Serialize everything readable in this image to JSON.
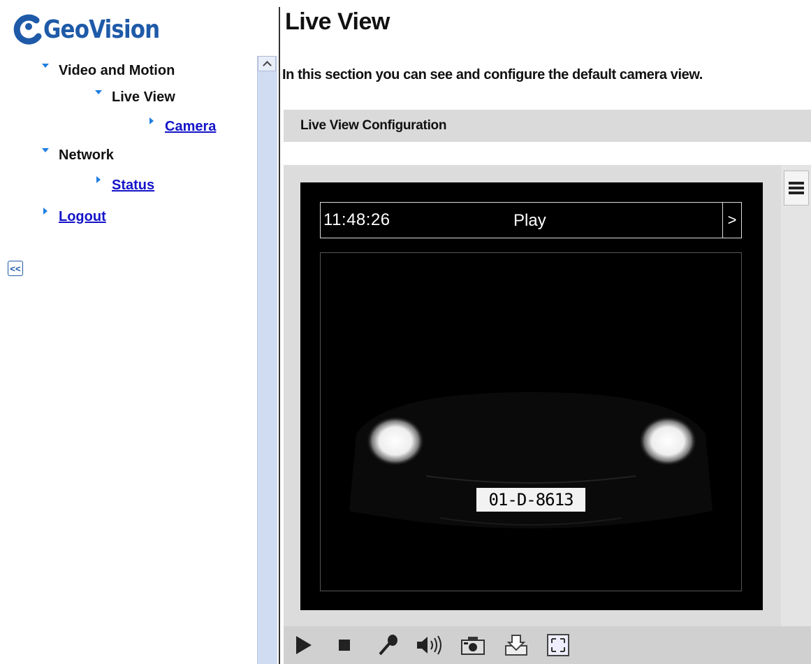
{
  "brand": {
    "name": "GeoVision"
  },
  "nav": {
    "video_and_motion": "Video and Motion",
    "live_view": "Live View",
    "camera": "Camera",
    "network": "Network",
    "status": "Status",
    "logout": "Logout",
    "collapse_label": "<<"
  },
  "page": {
    "title": "Live View",
    "description": "In this section you can see and configure the default camera view.",
    "section_title": "Live View Configuration"
  },
  "viewer": {
    "osd_time": "11:48:26",
    "osd_state": "Play",
    "osd_next": ">",
    "plate_text": "01-D-8613"
  },
  "toolbar": {
    "icons": [
      "play-icon",
      "stop-icon",
      "microphone-icon",
      "speaker-icon",
      "snapshot-icon",
      "download-icon",
      "fullscreen-icon"
    ]
  },
  "colors": {
    "brand": "#1e5aa8",
    "link": "#1414c8",
    "arrow": "#1e7fe0",
    "scrollbar": "#cfdcf2"
  }
}
